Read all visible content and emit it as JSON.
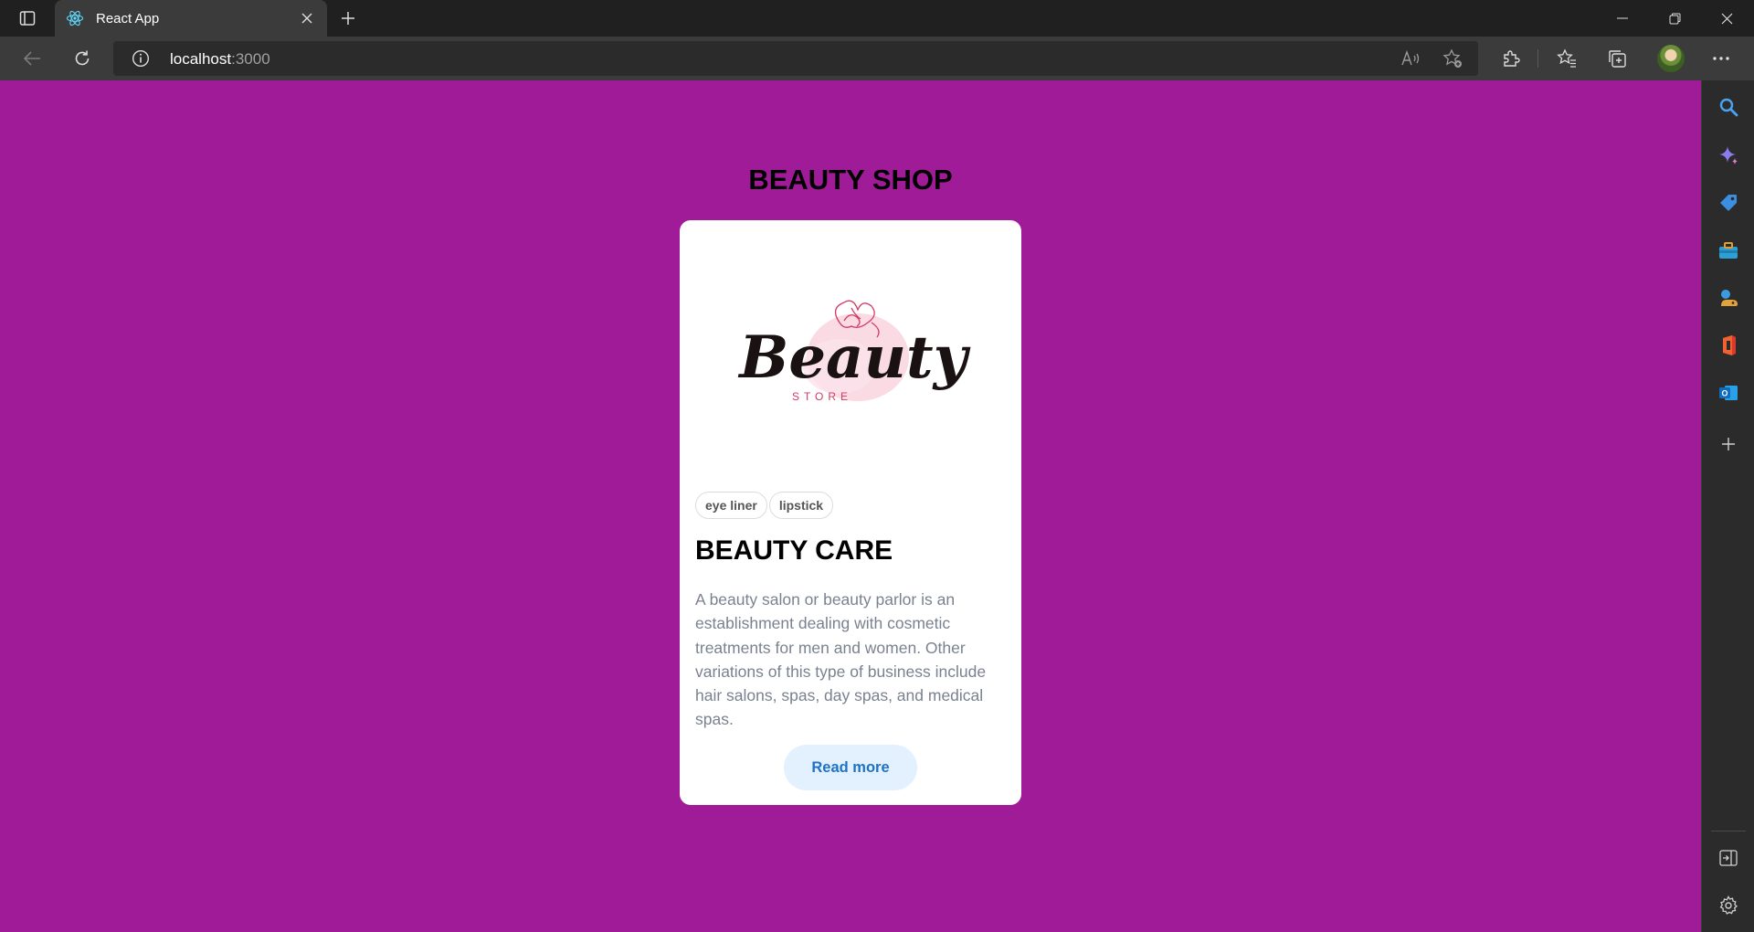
{
  "browser": {
    "tab": {
      "title": "React App",
      "favicon": "react-icon"
    },
    "address": {
      "host": "localhost",
      "port": ":3000"
    },
    "icons": {
      "tab_actions": "tab-actions-icon",
      "close_tab": "close-icon",
      "new_tab": "plus-icon",
      "back": "back-arrow-icon",
      "refresh": "refresh-icon",
      "site_info": "info-icon",
      "read_aloud": "read-aloud-icon",
      "add_favorite": "favorite-add-icon",
      "extensions": "extensions-icon",
      "favorites": "favorites-icon",
      "collections": "collections-icon",
      "more": "more-icon"
    },
    "window_controls": [
      "minimize",
      "restore",
      "close"
    ]
  },
  "page": {
    "background": "#a01b97",
    "title": "BEAUTY SHOP",
    "card": {
      "logo": {
        "script_text": "Beauty",
        "sub_text": "STORE"
      },
      "tags": [
        "eye liner",
        "lipstick"
      ],
      "title": "BEAUTY CARE",
      "description": "A beauty salon or beauty parlor is an establishment dealing with cosmetic treatments for men and women. Other variations of this type of business include hair salons, spas, day spas, and medical spas.",
      "button": "Read more"
    }
  },
  "sidebar": {
    "items": [
      "search-icon",
      "copilot-icon",
      "shopping-tag-icon",
      "tools-icon",
      "games-icon",
      "office-icon",
      "outlook-icon",
      "add-icon"
    ],
    "bottom": [
      "sidebar-toggle-icon",
      "settings-icon"
    ]
  }
}
